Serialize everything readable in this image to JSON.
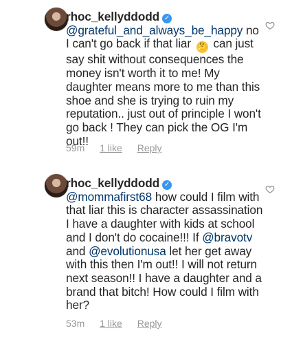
{
  "comments": [
    {
      "username": "rhoc_kellyddodd",
      "mention": "@grateful_and_always_be_happy",
      "text_before_emoji": " no I can't go back if that liar ",
      "emoji_name": "thinking-face-emoji",
      "text_after_emoji": " can just say shit without consequences the money isn't worth it to me! My daughter means more to me than this shoe and she is trying to ruin my reputation.. just out of principle I won't go back ! They can pick the OG I'm out!!",
      "time": "59m",
      "likes": "1 like",
      "reply": "Reply"
    },
    {
      "username": "rhoc_kellyddodd",
      "mention1": "@mommafirst68",
      "part1": " how could I film with that liar this is character assassination I have a daughter with kids at school and I don't do cocaine!!! If ",
      "mention2": "@bravotv",
      "part2": " and ",
      "mention3": "@evolutionusa",
      "part3": " let her get away with this then I'm out!! I will not return next season!! I have a daughter and a brand that bitch! How could I film with her?",
      "time": "53m",
      "likes": "1 like",
      "reply": "Reply"
    }
  ],
  "icons": {
    "verified": "verified-badge-icon",
    "heart": "heart-outline-icon"
  },
  "colors": {
    "mention": "#003569",
    "meta": "#999999",
    "verified": "#3897f0"
  }
}
